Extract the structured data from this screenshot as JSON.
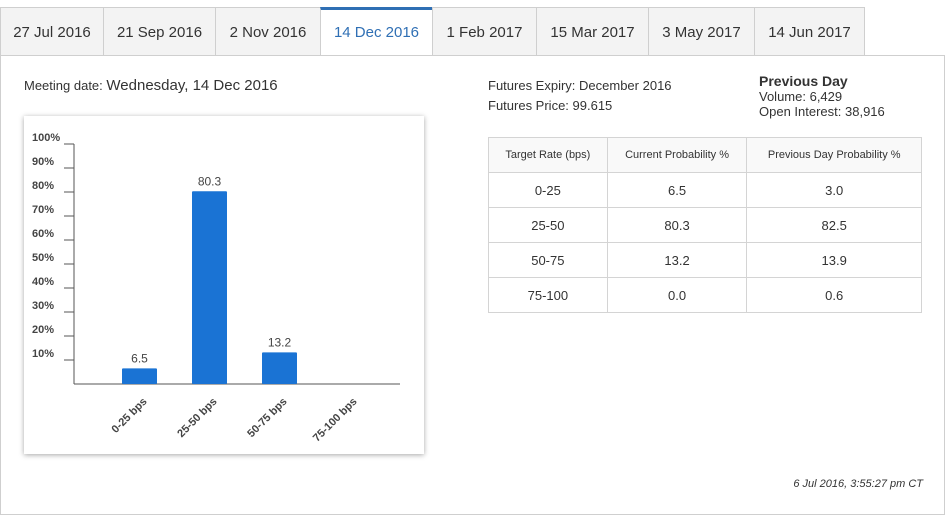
{
  "tabs": [
    {
      "label": "27 Jul 2016",
      "active": false
    },
    {
      "label": "21 Sep 2016",
      "active": false
    },
    {
      "label": "2 Nov 2016",
      "active": false
    },
    {
      "label": "14 Dec 2016",
      "active": true
    },
    {
      "label": "1 Feb 2017",
      "active": false
    },
    {
      "label": "15 Mar 2017",
      "active": false
    },
    {
      "label": "3 May 2017",
      "active": false
    },
    {
      "label": "14 Jun 2017",
      "active": false
    }
  ],
  "meeting": {
    "label": "Meeting date:",
    "date": "Wednesday, 14 Dec 2016"
  },
  "futures": {
    "expiry": "Futures Expiry: December 2016",
    "price": "Futures Price: 99.615"
  },
  "previous_day": {
    "title": "Previous Day",
    "volume": "Volume: 6,429",
    "open_interest": "Open Interest: 38,916"
  },
  "table": {
    "headers": [
      "Target Rate (bps)",
      "Current Probability %",
      "Previous Day Probability %"
    ],
    "rows": [
      [
        "0-25",
        "6.5",
        "3.0"
      ],
      [
        "25-50",
        "80.3",
        "82.5"
      ],
      [
        "50-75",
        "13.2",
        "13.9"
      ],
      [
        "75-100",
        "0.0",
        "0.6"
      ]
    ]
  },
  "timestamp": "6 Jul 2016, 3:55:27 pm CT",
  "colors": {
    "bar": "#1a73d4",
    "active_tab": "#2f6fb4"
  },
  "chart_data": {
    "type": "bar",
    "categories": [
      "0-25 bps",
      "25-50 bps",
      "50-75 bps",
      "75-100 bps"
    ],
    "values": [
      6.5,
      80.3,
      13.2,
      0.0
    ],
    "data_labels": [
      "6.5",
      "80.3",
      "13.2",
      ""
    ],
    "yticks": [
      "10%",
      "20%",
      "30%",
      "40%",
      "50%",
      "60%",
      "70%",
      "80%",
      "90%",
      "100%"
    ],
    "ylim": [
      0,
      100
    ],
    "title": "",
    "xlabel": "",
    "ylabel": "",
    "grid": false
  }
}
